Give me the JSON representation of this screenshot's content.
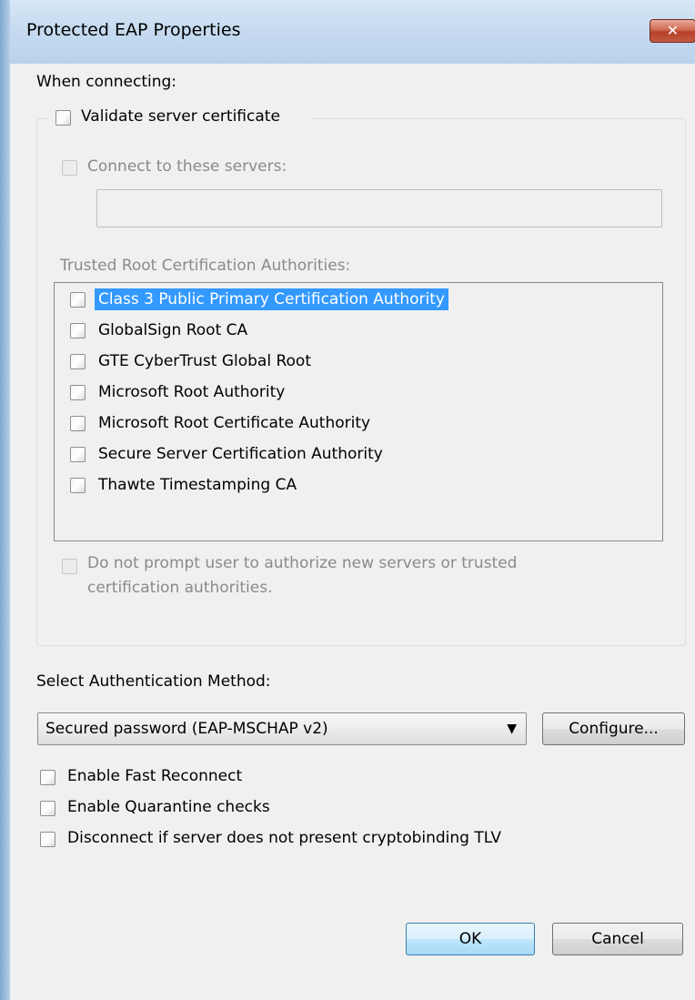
{
  "window": {
    "title": "Protected EAP Properties"
  },
  "icons": {
    "close": "close-icon",
    "dropdown": "chevron-down-icon"
  },
  "colors": {
    "selection": "#3399ff",
    "titlebar": "#c4d9ef",
    "close_button": "#c45a40"
  },
  "connecting": {
    "heading": "When connecting:",
    "validate_cert": {
      "label": "Validate server certificate",
      "checked": false
    },
    "connect_servers": {
      "label": "Connect to these servers:",
      "checked": false,
      "disabled": true,
      "value": ""
    },
    "trusted_heading": "Trusted Root Certification Authorities:",
    "authorities": [
      {
        "label": "Class 3 Public Primary Certification Authority",
        "checked": false,
        "selected": true
      },
      {
        "label": "GlobalSign Root CA",
        "checked": false,
        "selected": false
      },
      {
        "label": "GTE CyberTrust Global Root",
        "checked": false,
        "selected": false
      },
      {
        "label": "Microsoft Root Authority",
        "checked": false,
        "selected": false
      },
      {
        "label": "Microsoft Root Certificate Authority",
        "checked": false,
        "selected": false
      },
      {
        "label": "Secure Server Certification Authority",
        "checked": false,
        "selected": false
      },
      {
        "label": "Thawte Timestamping CA",
        "checked": false,
        "selected": false
      }
    ],
    "no_prompt": {
      "line1": "Do not prompt user to authorize new servers or trusted",
      "line2": "certification authorities.",
      "checked": false,
      "disabled": true
    }
  },
  "auth": {
    "heading": "Select Authentication Method:",
    "method": "Secured password (EAP-MSCHAP v2)",
    "configure_label": "Configure..."
  },
  "options": {
    "fast_reconnect": {
      "label": "Enable Fast Reconnect",
      "checked": false
    },
    "quarantine": {
      "label": "Enable Quarantine checks",
      "checked": false
    },
    "cryptobinding": {
      "label": "Disconnect if server does not present cryptobinding TLV",
      "checked": false
    }
  },
  "footer": {
    "ok_label": "OK",
    "cancel_label": "Cancel"
  }
}
